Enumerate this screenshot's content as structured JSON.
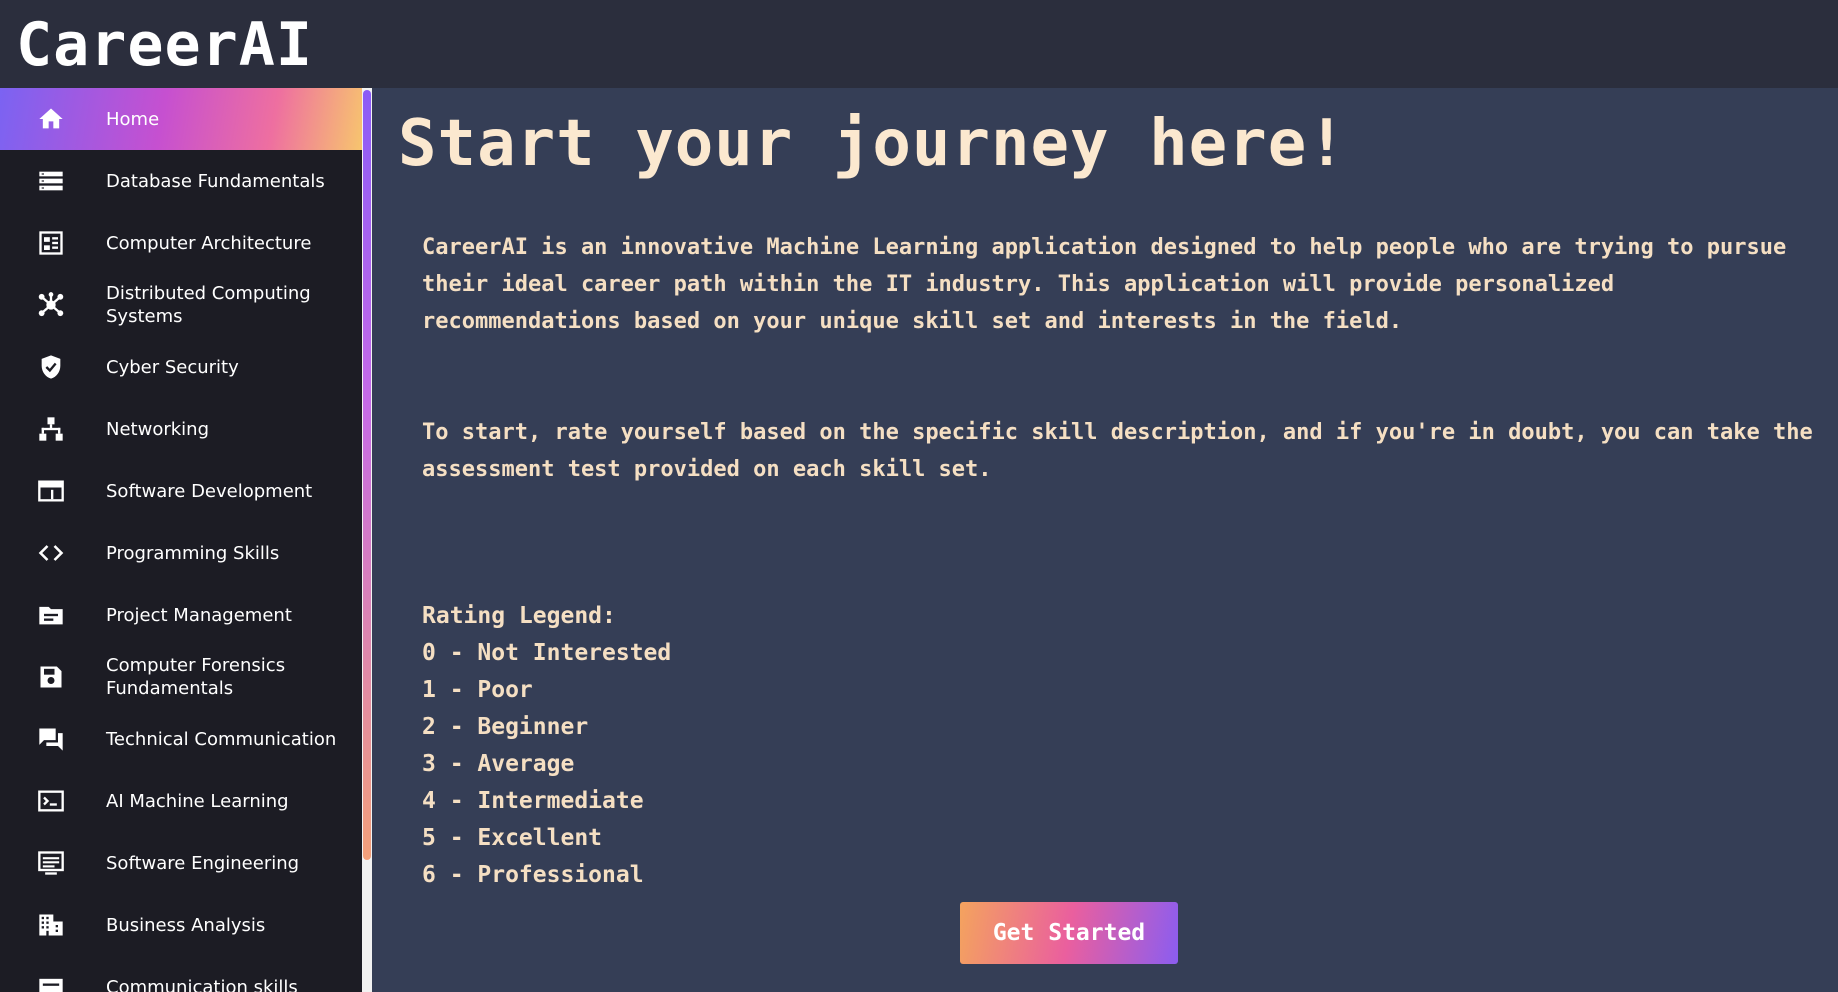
{
  "app": {
    "logo": "CareerAI"
  },
  "sidebar": {
    "items": [
      {
        "label": "Home",
        "icon": "home-icon",
        "active": true
      },
      {
        "label": "Database Fundamentals",
        "icon": "database-list-icon"
      },
      {
        "label": "Computer Architecture",
        "icon": "chip-board-icon"
      },
      {
        "label": "Distributed Computing Systems",
        "icon": "hub-network-icon"
      },
      {
        "label": "Cyber Security",
        "icon": "shield-check-icon"
      },
      {
        "label": "Networking",
        "icon": "network-tree-icon"
      },
      {
        "label": "Software Development",
        "icon": "window-app-icon"
      },
      {
        "label": "Programming Skills",
        "icon": "code-brackets-icon"
      },
      {
        "label": "Project Management",
        "icon": "folder-icon"
      },
      {
        "label": "Computer Forensics Fundamentals",
        "icon": "save-disk-icon"
      },
      {
        "label": "Technical Communication",
        "icon": "chat-bubbles-icon"
      },
      {
        "label": "AI Machine Learning",
        "icon": "terminal-icon"
      },
      {
        "label": "Software Engineering",
        "icon": "text-window-icon"
      },
      {
        "label": "Business Analysis",
        "icon": "building-icon"
      },
      {
        "label": "Communication skills",
        "icon": "card-icon"
      }
    ]
  },
  "main": {
    "title": "Start your journey here!",
    "intro": "CareerAI is an innovative Machine Learning application designed to help people who are trying to pursue their ideal career path within the IT industry. This application will provide personalized recommendations based on your unique skill set and interests in the field.",
    "instruction": "To start, rate yourself based on the specific skill description, and if you're in doubt, you can take the assessment test provided on each skill set.",
    "legend": {
      "title": "Rating Legend:",
      "items": [
        "0 - Not Interested",
        "1 - Poor",
        "2 - Beginner",
        "3 - Average",
        "4 - Intermediate",
        "5 - Excellent",
        "6 - Professional"
      ]
    },
    "cta_label": "Get Started"
  },
  "colors": {
    "background": "#353e56",
    "sidebar": "#1c1c24",
    "topbar": "#2b2e3d",
    "text": "#f5dfc3",
    "accent_gradient": [
      "#7b63f2",
      "#c650d0",
      "#f7c56e"
    ]
  }
}
